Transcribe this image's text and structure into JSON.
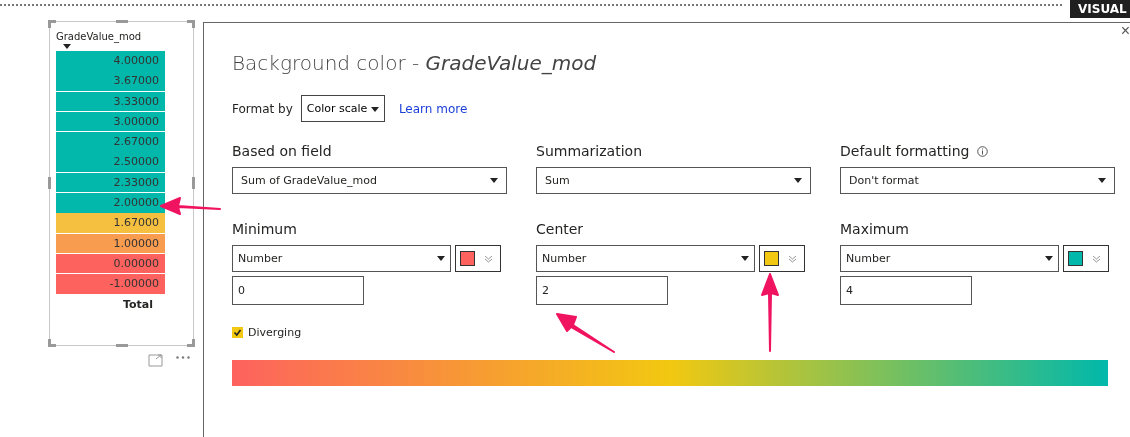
{
  "visual_tab": {
    "label": "VISUAL"
  },
  "table": {
    "header": "GradeValue_mod",
    "rows": [
      {
        "value": "4.00000",
        "color": "#01b8aa"
      },
      {
        "value": "3.67000",
        "color": "#01b8aa"
      },
      {
        "value": "3.33000",
        "color": "#01b8aa"
      },
      {
        "value": "3.00000",
        "color": "#01b8aa"
      },
      {
        "value": "2.67000",
        "color": "#01b8aa"
      },
      {
        "value": "2.50000",
        "color": "#01b8aa"
      },
      {
        "value": "2.33000",
        "color": "#01b8aa"
      },
      {
        "value": "2.00000",
        "color": "#01b8aa"
      },
      {
        "value": "1.67000",
        "color": "#f5c040"
      },
      {
        "value": "1.00000",
        "color": "#f89c50"
      },
      {
        "value": "0.00000",
        "color": "#fd625e"
      },
      {
        "value": "-1.00000",
        "color": "#fd625e"
      }
    ],
    "total": "Total"
  },
  "dialog": {
    "title": "Background color - ",
    "title_field": "GradeValue_mod",
    "close": "×",
    "format_by": {
      "label": "Format by",
      "value": "Color scale"
    },
    "learn_more": "Learn more",
    "fields": [
      {
        "label": "Based on field",
        "value": "Sum of GradeValue_mod",
        "info": false
      },
      {
        "label": "Summarization",
        "value": "Sum",
        "info": false
      },
      {
        "label": "Default formatting",
        "value": "Don't format",
        "info": true
      }
    ],
    "stops": [
      {
        "label": "Minimum",
        "type": "Number",
        "color": "#fd625e",
        "value": "0"
      },
      {
        "label": "Center",
        "type": "Number",
        "color": "#f2c811",
        "value": "2"
      },
      {
        "label": "Maximum",
        "type": "Number",
        "color": "#01b8aa",
        "value": "4"
      }
    ],
    "diverging": {
      "label": "Diverging",
      "checked": true
    }
  }
}
